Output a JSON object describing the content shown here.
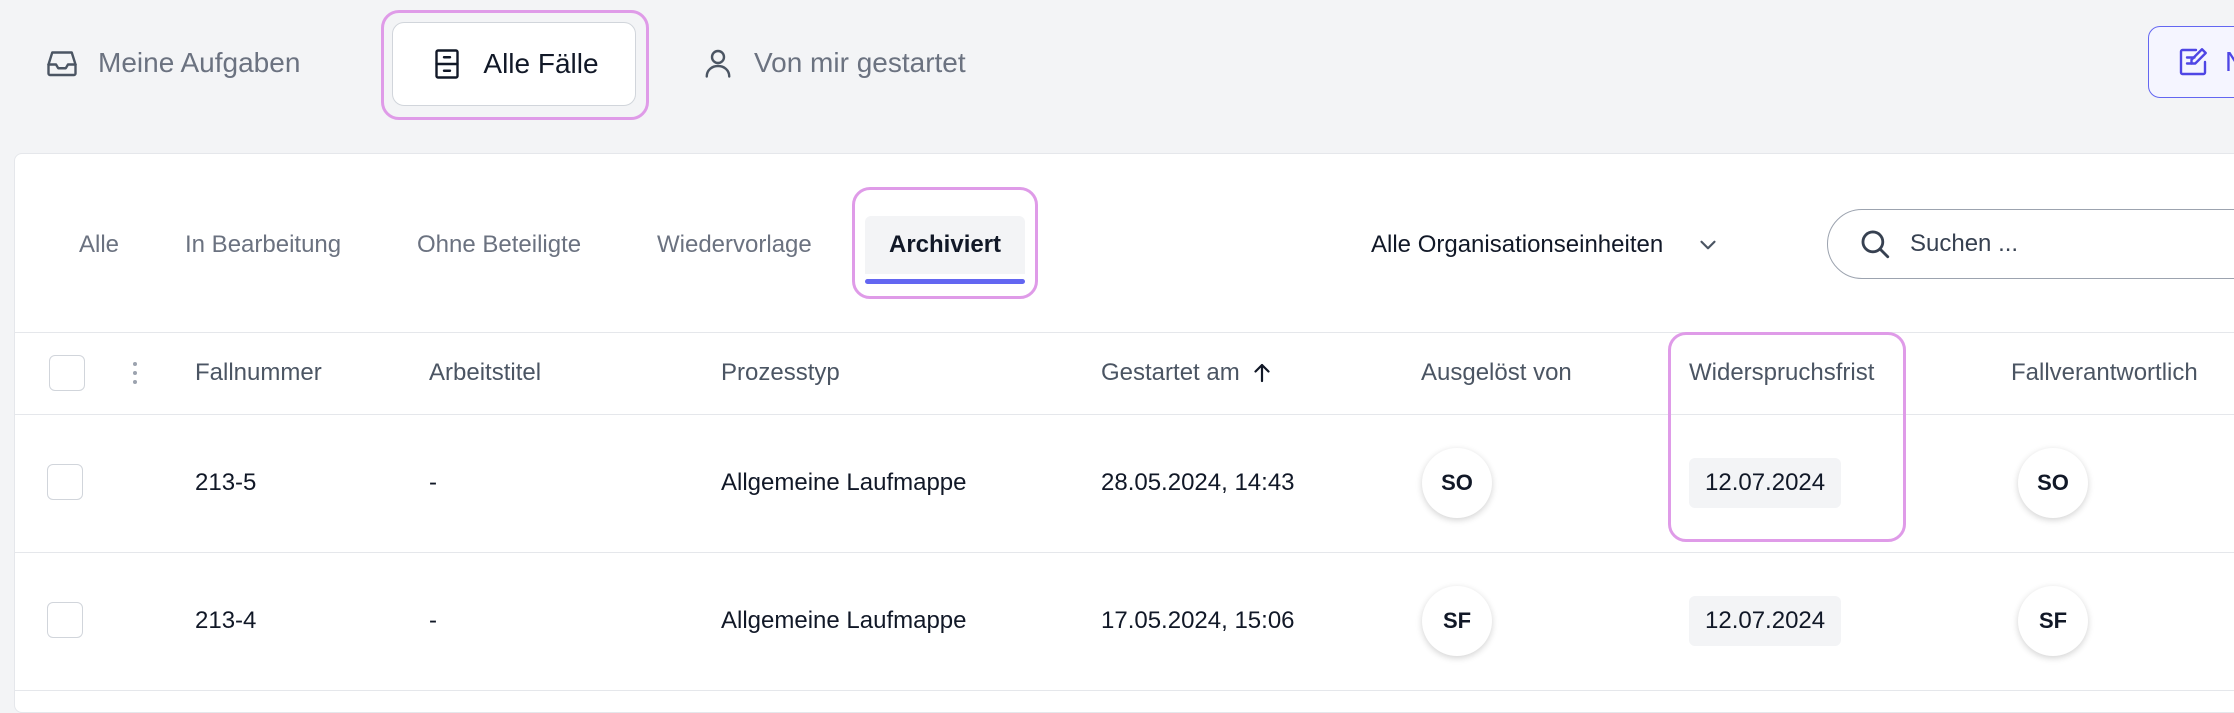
{
  "topnav": {
    "tabs": [
      {
        "label": "Meine Aufgaben",
        "icon": "inbox-icon"
      },
      {
        "label": "Alle Fälle",
        "icon": "archive-box-icon",
        "active": true
      },
      {
        "label": "Von mir gestartet",
        "icon": "user-icon"
      }
    ],
    "new_button": {
      "label": "Neu",
      "icon": "edit-note-icon"
    }
  },
  "filters": {
    "tabs": [
      {
        "label": "Alle"
      },
      {
        "label": "In Bearbeitung"
      },
      {
        "label": "Ohne Beteiligte"
      },
      {
        "label": "Wiedervorlage"
      },
      {
        "label": "Archiviert",
        "active": true
      }
    ],
    "org_select": {
      "value": "Alle Organisationseinheiten"
    },
    "search": {
      "placeholder": "Suchen ..."
    }
  },
  "table": {
    "columns": [
      {
        "label": "Fallnummer"
      },
      {
        "label": "Arbeitstitel"
      },
      {
        "label": "Prozesstyp"
      },
      {
        "label": "Gestartet am",
        "sort": "ascending"
      },
      {
        "label": "Ausgelöst von"
      },
      {
        "label": "Widerspruchsfrist"
      },
      {
        "label": "Fallverantwortlich"
      }
    ],
    "rows": [
      {
        "fallnummer": "213-5",
        "arbeitstitel": "-",
        "prozesstyp": "Allgemeine Laufmappe",
        "gestartet": "28.05.2024, 14:43",
        "ausgeloest": "SO",
        "frist": "12.07.2024",
        "verantwortlich": "SO"
      },
      {
        "fallnummer": "213-4",
        "arbeitstitel": "-",
        "prozesstyp": "Allgemeine Laufmappe",
        "gestartet": "17.05.2024, 15:06",
        "ausgeloest": "SF",
        "frist": "12.07.2024",
        "verantwortlich": "SF"
      }
    ]
  },
  "colors": {
    "accent": "#6366f1",
    "highlight": "#df9be8",
    "background": "#f3f4f6"
  }
}
